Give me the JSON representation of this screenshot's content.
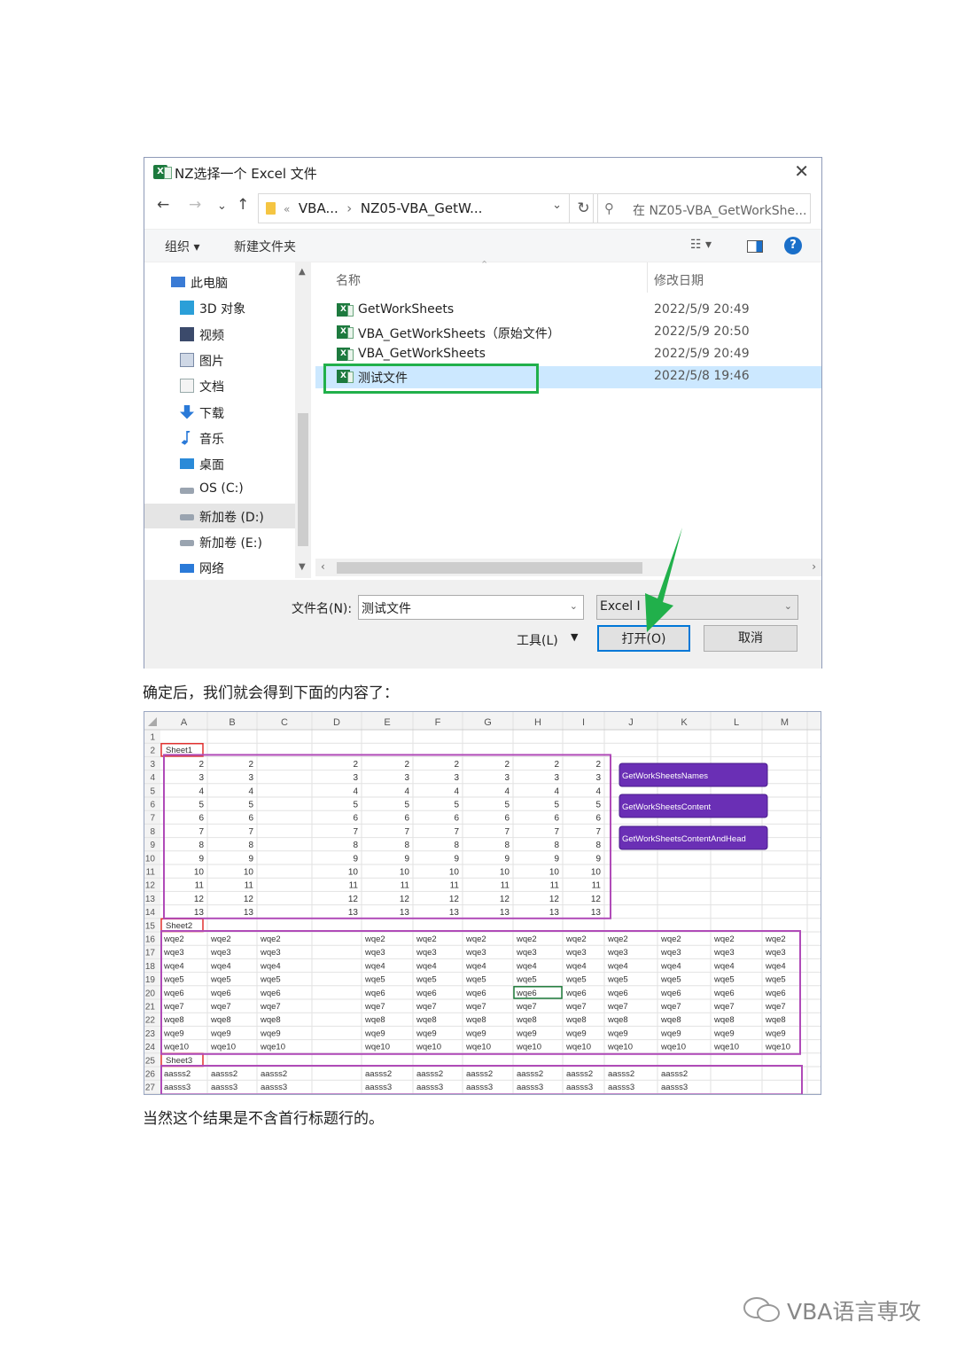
{
  "dialog": {
    "title": "NZ选择一个 Excel 文件",
    "title_icon": "X",
    "nav_buttons": {
      "back": "←",
      "forward": "→",
      "dropdown": "⌄",
      "up": "↑"
    },
    "breadcrumb": {
      "sep": "«",
      "part1": "VBA...",
      "sep2": "›",
      "part2": "NZ05-VBA_GetW..."
    },
    "search_placeholder": "在 NZ05-VBA_GetWorkShe...",
    "toolbar": {
      "organize": "组织 ▾",
      "new_folder": "新建文件夹"
    },
    "sidebar": [
      {
        "label": "此电脑",
        "icon": "computer-icon"
      },
      {
        "label": "3D 对象",
        "icon": "cube-icon"
      },
      {
        "label": "视频",
        "icon": "video-icon"
      },
      {
        "label": "图片",
        "icon": "picture-icon"
      },
      {
        "label": "文档",
        "icon": "document-icon"
      },
      {
        "label": "下载",
        "icon": "download-icon"
      },
      {
        "label": "音乐",
        "icon": "music-icon"
      },
      {
        "label": "桌面",
        "icon": "desktop-icon"
      },
      {
        "label": "OS (C:)",
        "icon": "drive-icon"
      },
      {
        "label": "新加卷 (D:)",
        "icon": "drive-icon",
        "selected": true
      },
      {
        "label": "新加卷 (E:)",
        "icon": "drive-icon"
      },
      {
        "label": "网络",
        "icon": "network-icon"
      }
    ],
    "columns": {
      "name": "名称",
      "date": "修改日期"
    },
    "files": [
      {
        "name": "GetWorkSheets",
        "date": "2022/5/9 20:49"
      },
      {
        "name": "VBA_GetWorkSheets（原始文件）",
        "date": "2022/5/9 20:50"
      },
      {
        "name": "VBA_GetWorkSheets",
        "date": "2022/5/9 20:49"
      },
      {
        "name": "测试文件",
        "date": "2022/5/8 19:46",
        "selected": true
      }
    ],
    "filename_label": "文件名(N):",
    "filename_value": "测试文件",
    "filetype_value": "Excel I",
    "tools_label": "工具(L)",
    "open_button": "打开(O)",
    "cancel_button": "取消",
    "highlight_color": "#21b04b"
  },
  "note1": "确定后，我们就会得到下面的内容了：",
  "spreadsheet": {
    "columns": [
      "A",
      "B",
      "C",
      "D",
      "E",
      "F",
      "G",
      "H",
      "I",
      "J",
      "K",
      "L",
      "M"
    ],
    "sheet_labels": [
      {
        "row": 2,
        "text": "Sheet1"
      },
      {
        "row": 15,
        "text": "Sheet2"
      },
      {
        "row": 25,
        "text": "Sheet3"
      }
    ],
    "sheet1_values": [
      2,
      3,
      4,
      5,
      6,
      7,
      8,
      9,
      10,
      11,
      12,
      13
    ],
    "sheet2_values": [
      "wqe2",
      "wqe3",
      "wqe4",
      "wqe5",
      "wqe6",
      "wqe7",
      "wqe8",
      "wqe9",
      "wqe10"
    ],
    "sheet3_values": [
      "aasss2",
      "aasss3"
    ],
    "buttons": [
      "GetWorkSheetsNames",
      "GetWorkSheetsContent",
      "GetWorkSheetsContentAndHead"
    ],
    "button_color": "#6a2fb5",
    "frame_color": "#b04bb8",
    "label_box_color": "#e0302f"
  },
  "note2": "当然这个结果是不含首行标题行的。",
  "watermark": "VBA语言専攻"
}
